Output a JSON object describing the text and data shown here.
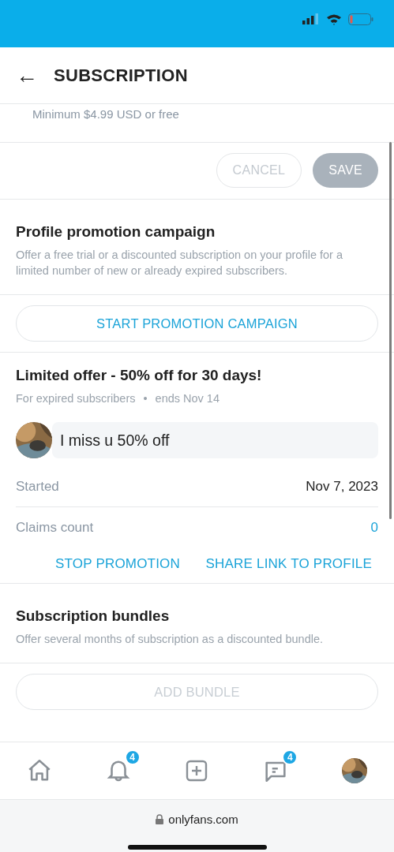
{
  "header": {
    "back": "←",
    "title": "SUBSCRIPTION"
  },
  "price_hint": "Minimum $4.99 USD or free",
  "form_buttons": [
    {
      "label": "CANCEL",
      "kind": "outline",
      "disabled": true
    },
    {
      "label": "SAVE",
      "kind": "filled",
      "disabled": true
    }
  ],
  "promotion": {
    "title": "Profile promotion campaign",
    "description": "Offer a free trial or a discounted subscription on your profile for a limited number of new or already expired subscribers.",
    "button": {
      "label": "START PROMOTION CAMPAIGN",
      "disabled": false
    }
  },
  "offer": {
    "title": "Limited offer - 50% off for 30 days!",
    "audience": "For expired subscribers",
    "separator": "•",
    "ends": "ends Nov 14",
    "message": {
      "text": "I miss u 50% off"
    },
    "rows": [
      {
        "label": "Started",
        "value": "Nov 7, 2023",
        "kind": "plain"
      },
      {
        "label": "Claims count",
        "value": "0",
        "kind": "link"
      }
    ],
    "actions": [
      "STOP PROMOTION",
      "SHARE LINK TO PROFILE"
    ]
  },
  "bundles": {
    "title": "Subscription bundles",
    "description": "Offer several months of subscription as a discounted bundle.",
    "button": {
      "label": "ADD BUNDLE",
      "disabled": true
    }
  },
  "nav": [
    {
      "kind": "home"
    },
    {
      "kind": "bell",
      "badge": "4"
    },
    {
      "kind": "add"
    },
    {
      "kind": "chat",
      "badge": "4"
    },
    {
      "kind": "avatar"
    }
  ],
  "browser": {
    "url": "onlyfans.com"
  }
}
